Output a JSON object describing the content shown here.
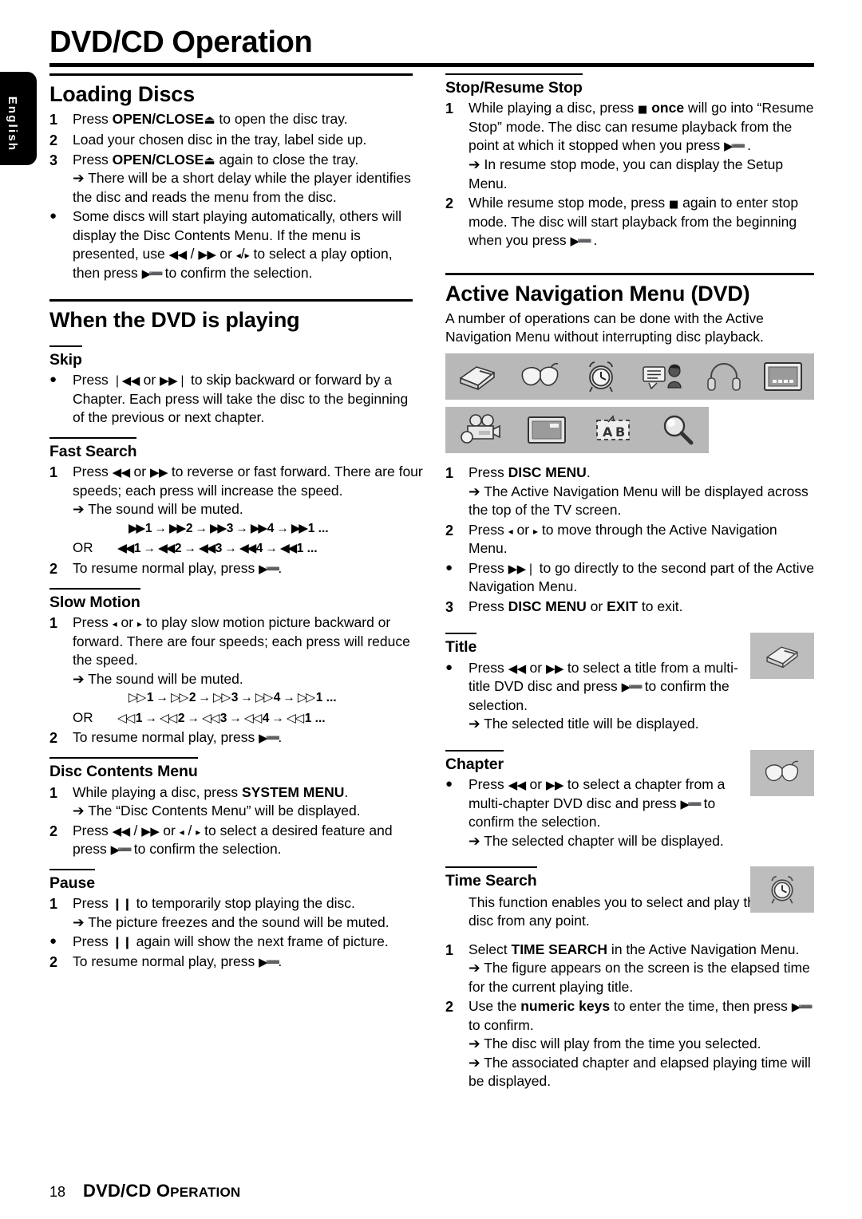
{
  "language_tab": {
    "label": "English"
  },
  "page_title": "DVD/CD Operation",
  "footer": {
    "page_number": "18",
    "title_first": "DVD/CD O",
    "title_rest": "PERATION"
  },
  "left_column": {
    "loading_discs": {
      "heading": "Loading Discs",
      "items": [
        {
          "marker": "1",
          "text_1": "Press ",
          "bold_1": "OPEN/CLOSE",
          "glyph": "⏏",
          "text_2": " to open the disc tray."
        },
        {
          "marker": "2",
          "text_1": "Load your chosen disc in the tray, label side up."
        },
        {
          "marker": "3",
          "text_1": "Press ",
          "bold_1": "OPEN/CLOSE",
          "glyph": "⏏",
          "text_2": " again to close the tray.",
          "sub": "➔ There will be a short delay while the player identifies the disc and reads the menu from the disc."
        },
        {
          "marker": "●",
          "text_1": "Some discs will start playing automatically, others will display the Disc Contents Menu.  If the menu is presented, use ",
          "g_rew": "◀◀",
          "mid_1": " / ",
          "g_ff": "▶▶",
          "mid_2": " or ",
          "g_left": "◂",
          "mid_3": "/",
          "g_right": "▸",
          "text_2": " to select a play option, then press ",
          "g_play": "▶➖",
          "text_3": " to confirm the selection."
        }
      ]
    },
    "when_dvd_playing": {
      "heading": "When the DVD is playing",
      "skip": {
        "heading": "Skip",
        "items": [
          {
            "marker": "●",
            "text_1": "Press ",
            "g_prev": "❘◀◀",
            "text_2": " or ",
            "g_next": "▶▶❘",
            "text_3": " to skip backward or forward by a Chapter.  Each press will take the disc to the beginning of the previous or next chapter."
          }
        ]
      },
      "fast_search": {
        "heading": "Fast Search",
        "items": [
          {
            "marker": "1",
            "text_1": "Press ",
            "g_rew": "◀◀",
            "text_2": " or ",
            "g_ff": "▶▶",
            "text_3": " to reverse or fast forward. There are four speeds; each press will increase the speed.",
            "sub": "➔ The sound will be muted."
          },
          {
            "marker": "2",
            "text_1": "To resume normal play, press ",
            "g_play": "▶➖",
            "text_2": "."
          }
        ],
        "sequence_forward": {
          "glyph": "▶▶",
          "steps": [
            "1",
            "2",
            "3",
            "4",
            "1"
          ],
          "arrow": "→",
          "ellipsis": "..."
        },
        "sequence_reverse": {
          "label": "OR",
          "glyph": "◀◀",
          "steps": [
            "1",
            "2",
            "3",
            "4",
            "1"
          ],
          "arrow": "→",
          "ellipsis": "..."
        }
      },
      "slow_motion": {
        "heading": "Slow Motion",
        "items": [
          {
            "marker": "1",
            "text_1": "Press ",
            "g_left": "◂",
            "text_2": " or ",
            "g_right": "▸",
            "text_3": " to play slow motion picture backward or forward. There are four speeds; each press will reduce the speed.",
            "sub": "➔ The sound will be muted."
          },
          {
            "marker": "2",
            "text_1": "To resume normal play, press ",
            "g_play": "▶➖",
            "text_2": "."
          }
        ],
        "sequence_forward": {
          "glyph": "▷▷",
          "steps": [
            "1",
            "2",
            "3",
            "4",
            "1"
          ],
          "arrow": "→",
          "ellipsis": "..."
        },
        "sequence_reverse": {
          "label": "OR",
          "glyph": "◁◁",
          "steps": [
            "1",
            "2",
            "3",
            "4",
            "1"
          ],
          "arrow": "→",
          "ellipsis": "..."
        }
      },
      "disc_contents_menu": {
        "heading": "Disc Contents Menu",
        "items": [
          {
            "marker": "1",
            "text_1": "While playing a disc, press ",
            "bold_1": "SYSTEM MENU",
            "text_2": ".",
            "sub": "➔ The “Disc Contents Menu” will be displayed."
          },
          {
            "marker": "2",
            "text_1": "Press ",
            "g_rew": "◀◀",
            "mid_1": " / ",
            "g_ff": "▶▶",
            "mid_2": " or ",
            "g_left": "◂",
            "mid_3": " / ",
            "g_right": "▸",
            "text_2": " to select a desired feature and press ",
            "g_play": "▶➖",
            "text_3": " to confirm the selection."
          }
        ]
      },
      "pause": {
        "heading": "Pause",
        "items": [
          {
            "marker": "1",
            "text_1": "Press ",
            "g_pause": "❙❙",
            "text_2": " to temporarily stop playing the disc.",
            "sub": "➔ The picture freezes and the sound will be muted."
          },
          {
            "marker": "●",
            "text_1": "Press ",
            "g_pause": "❙❙",
            "text_2": " again will show the next frame of picture."
          },
          {
            "marker": "2",
            "text_1": "To resume normal play, press ",
            "g_play": "▶➖",
            "text_2": "."
          }
        ]
      }
    }
  },
  "right_column": {
    "stop_resume_stop": {
      "heading": "Stop/Resume Stop",
      "items": [
        {
          "marker": "1",
          "text_1": "While playing a disc, press ",
          "g_stop": "■",
          "bold_1": " once",
          "text_2": " will go into “Resume Stop” mode. The disc can resume playback from the point at which it stopped when you press ",
          "g_play": "▶➖",
          "text_3": " .",
          "sub": "➔ In resume stop mode, you can display the Setup Menu."
        },
        {
          "marker": "2",
          "text_1": "While resume stop mode, press ",
          "g_stop": "■",
          "text_2": " again to enter stop mode. The disc will start playback from the beginning when you press ",
          "g_play": "▶➖",
          "text_3": " ."
        }
      ]
    },
    "active_navigation_menu": {
      "heading": "Active Navigation Menu (DVD)",
      "intro": "A number of operations can be done with the Active Navigation Menu without interrupting disc playback.",
      "icon_row_1": [
        "title-book-icon",
        "chapter-open-book-icon",
        "time-search-clock-icon",
        "subtitle-language-icon",
        "audio-headphones-icon",
        "screen-display-icon"
      ],
      "icon_row_2": [
        "camera-angle-icon",
        "picture-screen-icon",
        "ab-repeat-icon",
        "zoom-magnifier-icon"
      ],
      "items": [
        {
          "marker": "1",
          "text_1": "Press ",
          "bold_1": "DISC MENU",
          "text_2": ".",
          "sub": "➔ The Active Navigation Menu will be displayed across the top of the TV screen."
        },
        {
          "marker": "2",
          "text_1": "Press ",
          "g_left": "◂",
          "text_2": " or ",
          "g_right": "▸",
          "text_3": " to move through the Active Navigation Menu."
        },
        {
          "marker": "●",
          "text_1": "Press ",
          "g_next": "▶▶❘",
          "text_2": " to go directly to the second part of the Active Navigation Menu."
        },
        {
          "marker": "3",
          "text_1": "Press ",
          "bold_1": "DISC MENU",
          "text_2": " or ",
          "bold_2": "EXIT",
          "text_3": " to exit."
        }
      ]
    },
    "title": {
      "heading": "Title",
      "icon": "title-book-icon",
      "items": [
        {
          "marker": "●",
          "text_1": "Press ",
          "g_rew": "◀◀",
          "text_2": " or ",
          "g_ff": "▶▶",
          "text_3": " to select a title from a multi-title DVD disc and press ",
          "g_play": "▶➖",
          "text_4": " to confirm the selection.",
          "sub": "➔ The selected title will be displayed."
        }
      ]
    },
    "chapter": {
      "heading": "Chapter",
      "icon": "chapter-open-book-icon",
      "items": [
        {
          "marker": "●",
          "text_1": "Press ",
          "g_rew": "◀◀",
          "text_2": " or ",
          "g_ff": "▶▶",
          "text_3": " to select a chapter from a multi-chapter DVD disc and press ",
          "g_play": "▶➖",
          "text_4": " to confirm the selection.",
          "sub": "➔ The selected chapter will be displayed."
        }
      ]
    },
    "time_search": {
      "heading": "Time Search",
      "icon": "time-search-clock-icon",
      "intro": "This function enables you to select and play the disc from any point.",
      "items": [
        {
          "marker": "1",
          "text_1": "Select ",
          "bold_1": "TIME SEARCH",
          "text_2": " in the Active Navigation Menu.",
          "sub": "➔ The figure appears on the screen is the elapsed time for the current playing title."
        },
        {
          "marker": "2",
          "text_1": "Use the ",
          "bold_1": "numeric keys",
          "text_2": " to enter the time, then press ",
          "g_play": "▶➖",
          "text_3": " to confirm.",
          "sub": "➔ The disc will play from the time you selected.",
          "sub2": "➔ The associated chapter and elapsed playing time will be displayed."
        }
      ]
    }
  },
  "colors": {
    "icon_strip_bg": "#b8b8b8",
    "icon_box_bg": "#bdbdbd",
    "text": "#000000",
    "tab_bg": "#000000"
  }
}
